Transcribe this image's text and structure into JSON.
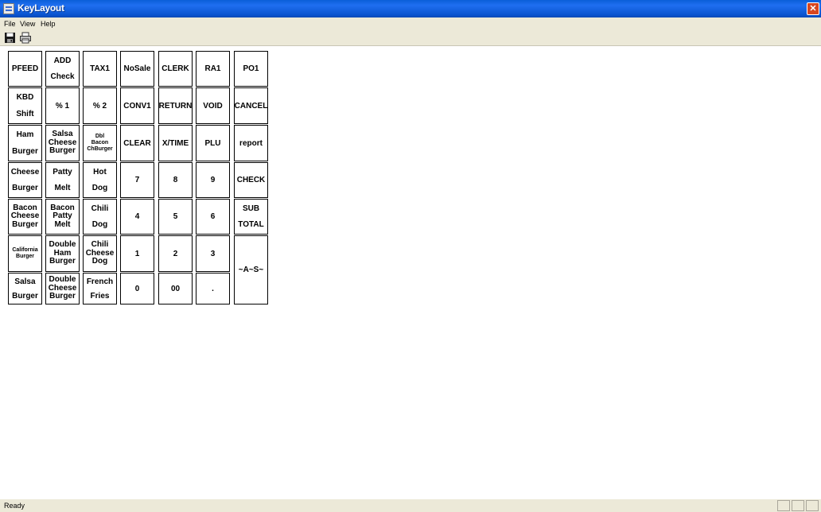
{
  "window": {
    "title": "KeyLayout",
    "close_symbol": "✕"
  },
  "menu": [
    "File",
    "View",
    "Help"
  ],
  "toolbar": {
    "buttons": [
      "save-icon",
      "print-icon"
    ]
  },
  "keys": [
    [
      {
        "lines": [
          "PFEED"
        ]
      },
      {
        "lines": [
          "ADD",
          "Check"
        ]
      },
      {
        "lines": [
          "TAX1"
        ]
      },
      {
        "lines": [
          "NoSale"
        ]
      },
      {
        "lines": [
          "CLERK"
        ]
      },
      {
        "lines": [
          "RA1"
        ]
      },
      {
        "lines": [
          "PO1"
        ]
      }
    ],
    [
      {
        "lines": [
          "KBD",
          "Shift"
        ]
      },
      {
        "lines": [
          "% 1"
        ]
      },
      {
        "lines": [
          "% 2"
        ]
      },
      {
        "lines": [
          "CONV1"
        ]
      },
      {
        "lines": [
          "RETURN"
        ]
      },
      {
        "lines": [
          "VOID"
        ]
      },
      {
        "lines": [
          "CANCEL"
        ]
      }
    ],
    [
      {
        "lines": [
          "Ham",
          "Burger"
        ]
      },
      {
        "lines": [
          "Salsa",
          "Cheese",
          "Burger"
        ]
      },
      {
        "lines": [
          "Dbl",
          "Bacon",
          "ChBurger"
        ],
        "tiny": true
      },
      {
        "lines": [
          "CLEAR"
        ]
      },
      {
        "lines": [
          "X/TIME"
        ]
      },
      {
        "lines": [
          "PLU"
        ]
      },
      {
        "lines": [
          "report"
        ]
      }
    ],
    [
      {
        "lines": [
          "Cheese",
          "Burger"
        ]
      },
      {
        "lines": [
          "Patty",
          "Melt"
        ]
      },
      {
        "lines": [
          "Hot",
          "Dog"
        ]
      },
      {
        "lines": [
          "7"
        ]
      },
      {
        "lines": [
          "8"
        ]
      },
      {
        "lines": [
          "9"
        ]
      },
      {
        "lines": [
          "CHECK"
        ]
      }
    ],
    [
      {
        "lines": [
          "Bacon",
          "Cheese",
          "Burger"
        ]
      },
      {
        "lines": [
          "Bacon",
          "Patty",
          "Melt"
        ]
      },
      {
        "lines": [
          "Chili",
          "Dog"
        ]
      },
      {
        "lines": [
          "4"
        ]
      },
      {
        "lines": [
          "5"
        ]
      },
      {
        "lines": [
          "6"
        ]
      },
      {
        "lines": [
          "SUB",
          "TOTAL"
        ]
      }
    ],
    [
      {
        "lines": [
          "California",
          "Burger"
        ],
        "tiny": true
      },
      {
        "lines": [
          "Double",
          "Ham",
          "Burger"
        ]
      },
      {
        "lines": [
          "Chili",
          "Cheese",
          "Dog"
        ]
      },
      {
        "lines": [
          "1"
        ]
      },
      {
        "lines": [
          "2"
        ]
      },
      {
        "lines": [
          "3"
        ]
      },
      {
        "lines": [
          "~A~S~"
        ],
        "rowspan": 2
      }
    ],
    [
      {
        "lines": [
          "Salsa",
          "Burger"
        ]
      },
      {
        "lines": [
          "Double",
          "Cheese",
          "Burger"
        ]
      },
      {
        "lines": [
          "French",
          "Fries"
        ]
      },
      {
        "lines": [
          "0"
        ]
      },
      {
        "lines": [
          "00"
        ]
      },
      {
        "lines": [
          "."
        ]
      }
    ]
  ],
  "status": {
    "text": "Ready"
  }
}
